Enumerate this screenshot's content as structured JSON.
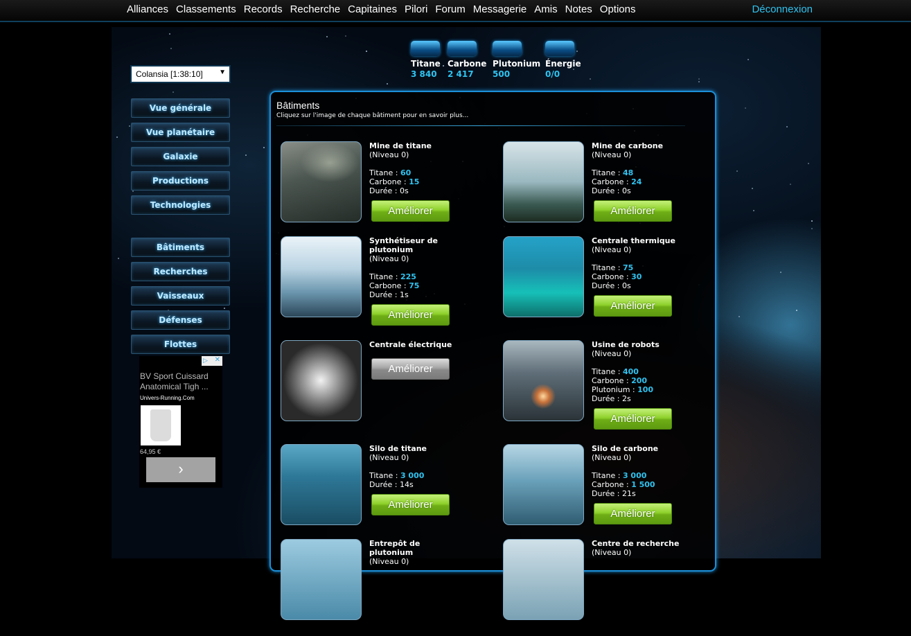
{
  "nav": {
    "items": [
      "Alliances",
      "Classements",
      "Records",
      "Recherche",
      "Capitaines",
      "Pilori",
      "Forum",
      "Messagerie",
      "Amis",
      "Notes",
      "Options"
    ],
    "logout": "Déconnexion"
  },
  "planet": {
    "selected": "Colansia [1:38:10]"
  },
  "menu": {
    "top": [
      "Vue générale",
      "Vue planétaire",
      "Galaxie",
      "Productions",
      "Technologies"
    ],
    "bottom": [
      "Bâtiments",
      "Recherches",
      "Vaisseaux",
      "Défenses",
      "Flottes"
    ]
  },
  "ad": {
    "title": "BV Sport Cuissard Anatomical Tigh ...",
    "source": "Univers-Running.Com",
    "price": "64,95 €",
    "next_icon": "chevron-right-icon"
  },
  "resources": [
    {
      "name": "Titane",
      "value": "3 840",
      "icon": "titane-icon"
    },
    {
      "name": "Carbone",
      "value": "2 417",
      "icon": "carbone-icon"
    },
    {
      "name": "Plutonium",
      "value": "500",
      "icon": "plutonium-icon"
    },
    {
      "name": "Énergie",
      "value": "0/0",
      "icon": "energie-icon"
    }
  ],
  "buildings_panel": {
    "title": "Bâtiments",
    "subtitle": "Cliquez sur l'image de chaque bâtiment pour en savoir plus...",
    "upgrade_label": "Améliorer",
    "buildings": [
      {
        "name": "Mine de titane",
        "level": "(Niveau 0)",
        "costs": [
          {
            "label": "Titane",
            "value": "60"
          },
          {
            "label": "Carbone",
            "value": "15"
          }
        ],
        "duration": "0s",
        "available": true
      },
      {
        "name": "Mine de carbone",
        "level": "(Niveau 0)",
        "costs": [
          {
            "label": "Titane",
            "value": "48"
          },
          {
            "label": "Carbone",
            "value": "24"
          }
        ],
        "duration": "0s",
        "available": true
      },
      {
        "name": "Synthétiseur de plutonium",
        "level": "(Niveau 0)",
        "costs": [
          {
            "label": "Titane",
            "value": "225"
          },
          {
            "label": "Carbone",
            "value": "75"
          }
        ],
        "duration": "1s",
        "available": true
      },
      {
        "name": "Centrale thermique",
        "level": "(Niveau 0)",
        "costs": [
          {
            "label": "Titane",
            "value": "75"
          },
          {
            "label": "Carbone",
            "value": "30"
          }
        ],
        "duration": "0s",
        "available": true
      },
      {
        "name": "Centrale électrique",
        "level": "",
        "costs": [],
        "duration": "",
        "available": false
      },
      {
        "name": "Usine de robots",
        "level": "(Niveau 0)",
        "costs": [
          {
            "label": "Titane",
            "value": "400"
          },
          {
            "label": "Carbone",
            "value": "200"
          },
          {
            "label": "Plutonium",
            "value": "100"
          }
        ],
        "duration": "2s",
        "available": true
      },
      {
        "name": "Silo de titane",
        "level": "(Niveau 0)",
        "costs": [
          {
            "label": "Titane",
            "value": "3 000"
          }
        ],
        "duration": "14s",
        "available": true
      },
      {
        "name": "Silo de carbone",
        "level": "(Niveau 0)",
        "costs": [
          {
            "label": "Titane",
            "value": "3 000"
          },
          {
            "label": "Carbone",
            "value": "1 500"
          }
        ],
        "duration": "21s",
        "available": true
      },
      {
        "name": "Entrepôt de plutonium",
        "level": "(Niveau 0)",
        "costs": [],
        "duration": "",
        "available": true
      },
      {
        "name": "Centre de recherche",
        "level": "(Niveau 0)",
        "costs": [],
        "duration": "",
        "available": true
      }
    ]
  },
  "labels": {
    "duration": "Durée"
  }
}
